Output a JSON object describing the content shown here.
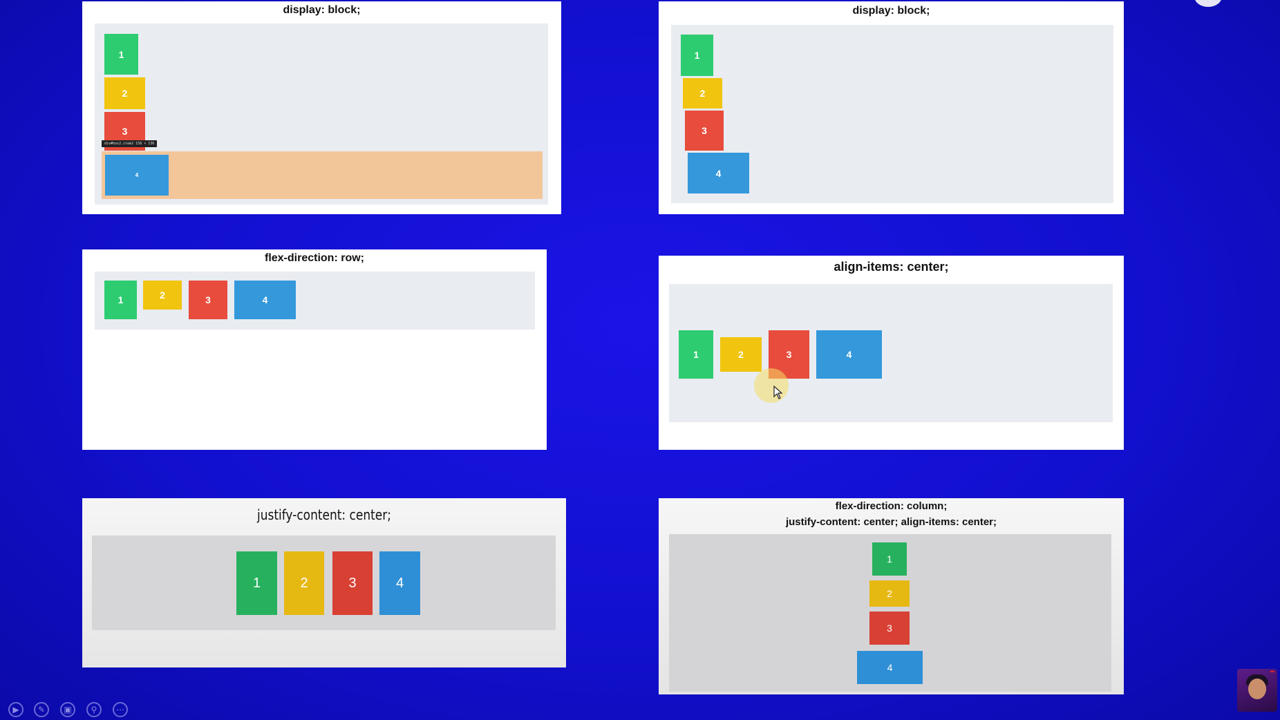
{
  "slides": {
    "s1": {
      "title": "display: block;",
      "boxes": [
        "1",
        "2",
        "3",
        "4"
      ],
      "tooltip": "div#box2.item2  158 × 136"
    },
    "s2": {
      "title": "display: block;",
      "boxes": [
        "1",
        "2",
        "3",
        "4"
      ]
    },
    "s3": {
      "title": "flex-direction: row;",
      "boxes": [
        "1",
        "2",
        "3",
        "4"
      ]
    },
    "s4": {
      "title": "align-items: center;",
      "boxes": [
        "1",
        "2",
        "3",
        "4"
      ]
    },
    "s5": {
      "title": "justify-content: center;",
      "boxes": [
        "1",
        "2",
        "3",
        "4"
      ]
    },
    "s6": {
      "title_line1": "flex-direction: column;",
      "title_line2": "justify-content: center; align-items: center;",
      "boxes": [
        "1",
        "2",
        "3",
        "4"
      ]
    }
  },
  "controls": [
    "play-icon",
    "pen-icon",
    "slides-icon",
    "zoom-icon",
    "more-icon"
  ],
  "colors": {
    "background": "#1210cf",
    "green": "#2ecc71",
    "yellow": "#f1c40f",
    "red": "#e74c3c",
    "blue": "#3498db",
    "highlight": "#f3c69a"
  }
}
